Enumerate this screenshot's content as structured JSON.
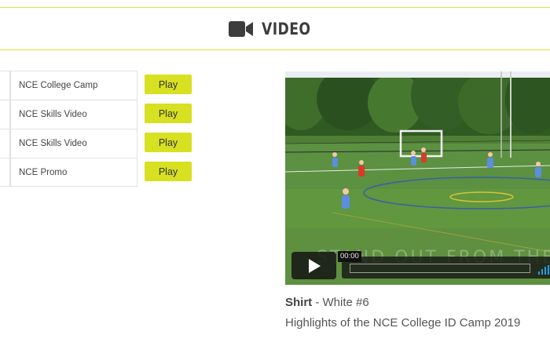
{
  "header": {
    "title": "VIDEO",
    "icon": "video-camera-icon"
  },
  "videos": [
    {
      "title": "NCE College Camp",
      "play_label": "Play"
    },
    {
      "title": "NCE Skills Video",
      "play_label": "Play"
    },
    {
      "title": "NCE Skills Video",
      "play_label": "Play"
    },
    {
      "title": "NCE Promo",
      "play_label": "Play"
    }
  ],
  "player": {
    "current_time": "00:00",
    "overlay_text": "STAND OUT FROM THE",
    "progress": 0
  },
  "caption": {
    "shirt_label": "Shirt",
    "shirt_value": " - White #6",
    "description": "Highlights of the NCE College ID Camp 2019"
  },
  "colors": {
    "accent": "#d7e021",
    "border": "#d8e33a",
    "text": "#3d3d3d"
  }
}
